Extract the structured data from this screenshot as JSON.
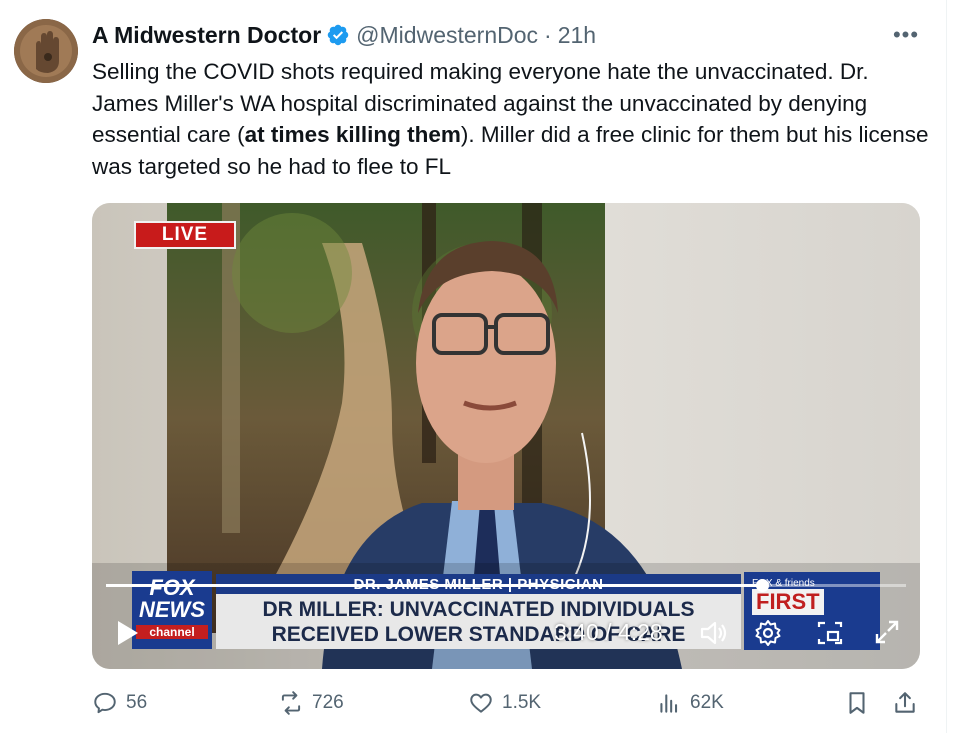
{
  "author": {
    "name": "A Midwestern Doctor",
    "handle": "@MidwesternDoc",
    "separator": "·",
    "time": "21h",
    "verified_color": "#1d9bf0"
  },
  "tweet": {
    "text_part1": "Selling the COVID shots required making everyone hate the unvaccinated. Dr. James Miller's WA hospital discriminated against the unvaccinated by denying essential care (",
    "text_bold": "at times killing them",
    "text_part2": "). Miller did a free clinic for them but his license was targeted so he had to flee to FL"
  },
  "video": {
    "live_badge": "LIVE",
    "chyron_name": "DR. JAMES MILLER | PHYSICIAN",
    "chyron_line1": "DR MILLER: UNVACCINATED INDIVIDUALS",
    "chyron_line2": "RECEIVED LOWER STANDARD OF CARE",
    "fox_logo": [
      "FOX",
      "NEWS",
      "channel"
    ],
    "promo_small": "FOX & friends",
    "promo_big": "FIRST",
    "current_time": "3:40",
    "duration": "4:28",
    "timecode": "3:40 / 4:28",
    "progress_fraction": 0.82,
    "controls": [
      "play-icon",
      "volume-icon",
      "settings-gear-icon",
      "picture-in-picture-icon",
      "fullscreen-icon"
    ]
  },
  "actions": {
    "replies": "56",
    "reposts": "726",
    "likes": "1.5K",
    "views": "62K"
  },
  "colors": {
    "text": "#0f1419",
    "muted": "#536471",
    "accent": "#1d9bf0",
    "live_red": "#c81b1b",
    "fox_blue": "#1a3b8f"
  }
}
